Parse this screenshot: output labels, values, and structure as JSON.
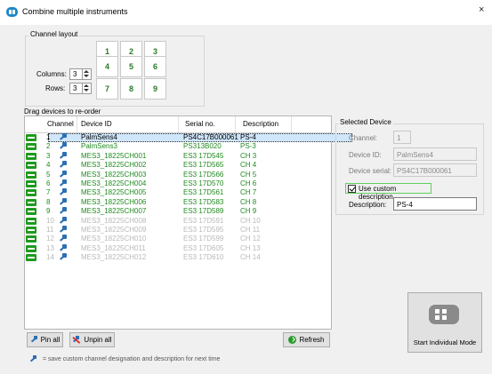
{
  "window": {
    "title": "Combine multiple instruments",
    "close_glyph": "×"
  },
  "channel_layout": {
    "legend": "Channel layout",
    "columns_label": "Columns:",
    "rows_label": "Rows:",
    "columns_value": "3",
    "rows_value": "3",
    "cells": [
      "1",
      "2",
      "3",
      "4",
      "5",
      "6",
      "7",
      "8",
      "9"
    ]
  },
  "list": {
    "title": "Drag devices to re-order",
    "headers": {
      "channel": "Channel",
      "device_id": "Device ID",
      "serial": "Serial no.",
      "description": "Description"
    },
    "rows": [
      {
        "ch": "1",
        "id": "PalmSens4",
        "serial": "PS4C17B000061",
        "desc": "PS-4",
        "state": "selected"
      },
      {
        "ch": "2",
        "id": "PalmSens3",
        "serial": "PS313B020",
        "desc": "PS-3",
        "state": "active"
      },
      {
        "ch": "3",
        "id": "MES3_18225CH001",
        "serial": "ES3 17D545",
        "desc": "CH 3",
        "state": "active"
      },
      {
        "ch": "4",
        "id": "MES3_18225CH002",
        "serial": "ES3 17D565",
        "desc": "CH 4",
        "state": "active"
      },
      {
        "ch": "5",
        "id": "MES3_18225CH003",
        "serial": "ES3 17D566",
        "desc": "CH 5",
        "state": "active"
      },
      {
        "ch": "6",
        "id": "MES3_18225CH004",
        "serial": "ES3 17D570",
        "desc": "CH 6",
        "state": "active"
      },
      {
        "ch": "7",
        "id": "MES3_18225CH005",
        "serial": "ES3 17D561",
        "desc": "CH 7",
        "state": "active"
      },
      {
        "ch": "8",
        "id": "MES3_18225CH006",
        "serial": "ES3 17D583",
        "desc": "CH 8",
        "state": "active"
      },
      {
        "ch": "9",
        "id": "MES3_18225CH007",
        "serial": "ES3 17D589",
        "desc": "CH 9",
        "state": "active"
      },
      {
        "ch": "10",
        "id": "MES3_18225CH008",
        "serial": "ES3 17D591",
        "desc": "CH 10",
        "state": "inactive"
      },
      {
        "ch": "11",
        "id": "MES3_18225CH009",
        "serial": "ES3 17D595",
        "desc": "CH 11",
        "state": "inactive"
      },
      {
        "ch": "12",
        "id": "MES3_18225CH010",
        "serial": "ES3 17D599",
        "desc": "CH 12",
        "state": "inactive"
      },
      {
        "ch": "13",
        "id": "MES3_18225CH011",
        "serial": "ES3 17D605",
        "desc": "CH 13",
        "state": "inactive"
      },
      {
        "ch": "14",
        "id": "MES3_18225CH012",
        "serial": "ES3 17D610",
        "desc": "CH 14",
        "state": "inactive"
      }
    ]
  },
  "buttons": {
    "pin_all": "Pin all",
    "unpin_all": "Unpin all",
    "refresh": "Refresh",
    "start_individual": "Start Individual Mode"
  },
  "footer_note": "= save custom channel designation and description for next time",
  "selected_device": {
    "legend": "Selected Device",
    "channel_label": "Channel:",
    "channel_value": "1",
    "device_id_label": "Device ID:",
    "device_id_value": "PalmSens4",
    "serial_label": "Device serial:",
    "serial_value": "PS4C17B000061",
    "custom_desc_label": "Use custom description",
    "description_label": "Description:",
    "description_value": "PS-4"
  },
  "colors": {
    "active": "#1f8a1f",
    "inactive": "#b9b9b9",
    "accent": "#1e88c7",
    "handle": "#1e9a1e"
  }
}
